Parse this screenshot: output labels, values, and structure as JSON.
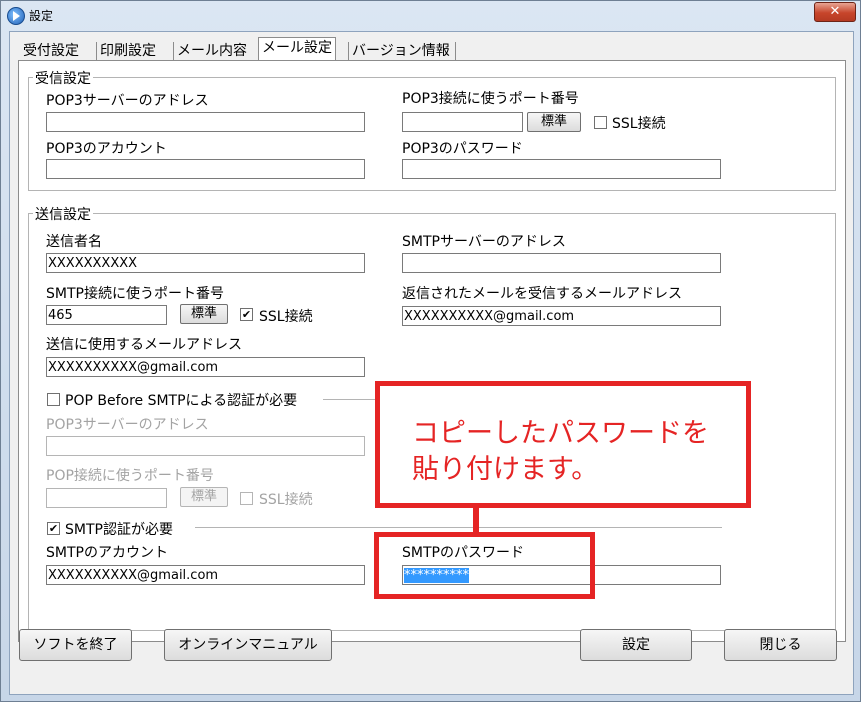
{
  "window": {
    "title": "設定",
    "close_glyph": "✕"
  },
  "tabs": [
    {
      "label": "受付設定",
      "active": false
    },
    {
      "label": "印刷設定",
      "active": false
    },
    {
      "label": "メール内容",
      "active": false
    },
    {
      "label": "メール設定",
      "active": true
    },
    {
      "label": "バージョン情報",
      "active": false
    }
  ],
  "receive": {
    "group_title": "受信設定",
    "pop3_server_label": "POP3サーバーのアドレス",
    "pop3_server_value": "",
    "pop3_port_label": "POP3接続に使うポート番号",
    "pop3_port_value": "",
    "default_button": "標準",
    "ssl_label": "SSL接続",
    "ssl_checked": false,
    "pop3_account_label": "POP3のアカウント",
    "pop3_account_value": "",
    "pop3_password_label": "POP3のパスワード",
    "pop3_password_value": ""
  },
  "send": {
    "group_title": "送信設定",
    "sender_name_label": "送信者名",
    "sender_name_value": "XXXXXXXXXX",
    "smtp_server_label": "SMTPサーバーのアドレス",
    "smtp_server_value": "",
    "smtp_port_label": "SMTP接続に使うポート番号",
    "smtp_port_value": "465",
    "default_button": "標準",
    "ssl_label": "SSL接続",
    "ssl_checked": "✔",
    "reply_address_label": "返信されたメールを受信するメールアドレス",
    "reply_address_value": "XXXXXXXXXX@gmail.com",
    "send_address_label": "送信に使用するメールアドレス",
    "send_address_value": "XXXXXXXXXX@gmail.com",
    "pop_before_label": "POP Before SMTPによる認証が必要",
    "pop_before_checked": false,
    "pb_pop3_server_label": "POP3サーバーのアドレス",
    "pb_pop3_server_value": "",
    "pb_port_label": "POP接続に使うポート番号",
    "pb_port_value": "",
    "pb_default_button": "標準",
    "pb_ssl_label": "SSL接続",
    "smtp_auth_label": "SMTP認証が必要",
    "smtp_auth_checked": "✔",
    "smtp_account_label": "SMTPのアカウント",
    "smtp_account_value": "XXXXXXXXXX@gmail.com",
    "smtp_password_label": "SMTPのパスワード",
    "smtp_password_value": "**********"
  },
  "annotation": {
    "line1": "コピーしたパスワードを",
    "line2": "貼り付けます。",
    "color": "#e52424"
  },
  "footer": {
    "quit_button": "ソフトを終了",
    "manual_button": "オンラインマニュアル",
    "settings_button": "設定",
    "close_button": "閉じる"
  }
}
